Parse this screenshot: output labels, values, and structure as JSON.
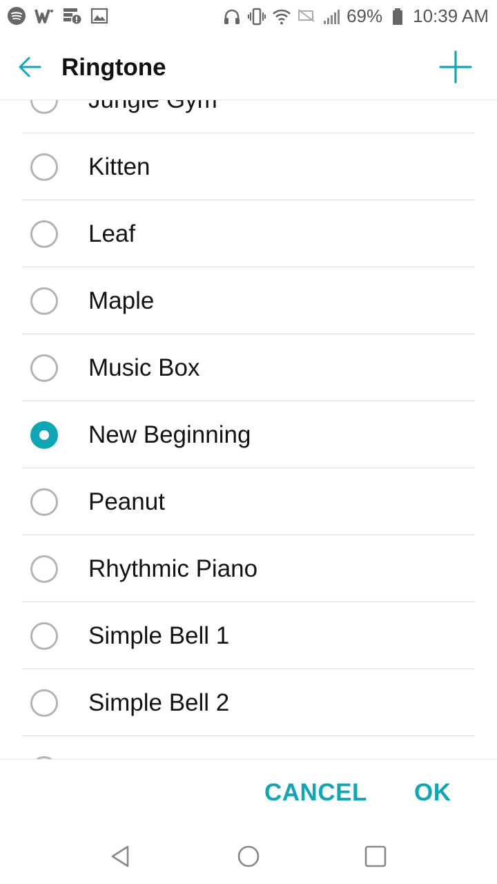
{
  "status_bar": {
    "left_icons": [
      "spotify-icon",
      "w-app-icon",
      "notification-alert-icon",
      "image-icon"
    ],
    "battery_percent": "69%",
    "time": "10:39 AM",
    "right_icons": [
      "headphones-icon",
      "vibrate-icon",
      "wifi-icon",
      "no-sim-icon",
      "signal-icon",
      "battery-icon"
    ]
  },
  "app_bar": {
    "title": "Ringtone",
    "back_icon": "back-arrow-icon",
    "add_icon": "plus-icon"
  },
  "ringtones": {
    "items": [
      {
        "label": "Jungle Gym",
        "selected": false
      },
      {
        "label": "Kitten",
        "selected": false
      },
      {
        "label": "Leaf",
        "selected": false
      },
      {
        "label": "Maple",
        "selected": false
      },
      {
        "label": "Music Box",
        "selected": false
      },
      {
        "label": "New Beginning",
        "selected": true
      },
      {
        "label": "Peanut",
        "selected": false
      },
      {
        "label": "Rhythmic Piano",
        "selected": false
      },
      {
        "label": "Simple Bell 1",
        "selected": false
      },
      {
        "label": "Simple Bell 2",
        "selected": false
      },
      {
        "label": "",
        "selected": false
      }
    ]
  },
  "footer": {
    "cancel_label": "CANCEL",
    "ok_label": "OK"
  },
  "colors": {
    "accent": "#11a6b6",
    "divider": "#dcdcdc",
    "radio_unchecked": "#b3b3b3"
  }
}
